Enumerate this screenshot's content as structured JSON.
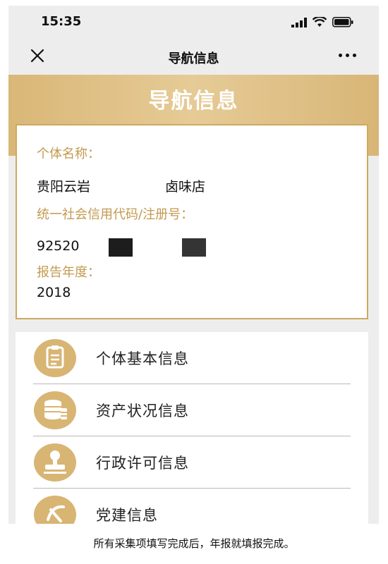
{
  "status_bar": {
    "time": "15:35"
  },
  "nav": {
    "title": "导航信息"
  },
  "banner": {
    "title": "导航信息"
  },
  "card": {
    "name_label": "个体名称：",
    "name_value_part1": "贵阳云岩",
    "name_value_part2": "卤味店",
    "code_label": "统一社会信用代码/注册号：",
    "code_value": "92520",
    "year_label": "报告年度：",
    "year_value": "2018"
  },
  "menu": {
    "items": [
      {
        "label": "个体基本信息",
        "icon": "clipboard-icon"
      },
      {
        "label": "资产状况信息",
        "icon": "coins-icon"
      },
      {
        "label": "行政许可信息",
        "icon": "stamp-icon"
      },
      {
        "label": "党建信息",
        "icon": "party-emblem-icon"
      }
    ]
  },
  "caption": "所有采集项填写完成后，年报就填报完成。",
  "colors": {
    "gold": "#d8b573",
    "gold_text": "#c29a50",
    "background": "#ededed"
  }
}
